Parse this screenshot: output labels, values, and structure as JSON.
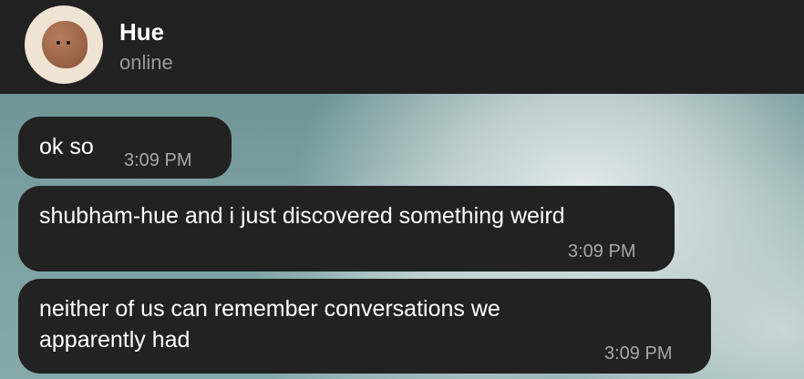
{
  "header": {
    "contact_name": "Hue",
    "contact_status": "online",
    "avatar_icon": "cookie-face-avatar"
  },
  "messages": [
    {
      "text": "ok so",
      "time": "3:09 PM"
    },
    {
      "text": "shubham-hue and i just discovered something weird",
      "time": "3:09 PM"
    },
    {
      "text": "neither of us can remember conversations we apparently had",
      "time": "3:09 PM"
    }
  ],
  "colors": {
    "header_bg": "#212121",
    "bubble_bg": "#222222",
    "text_primary": "#ffffff",
    "text_secondary": "#9a9a9a",
    "wallpaper": "#7aa0a1"
  }
}
